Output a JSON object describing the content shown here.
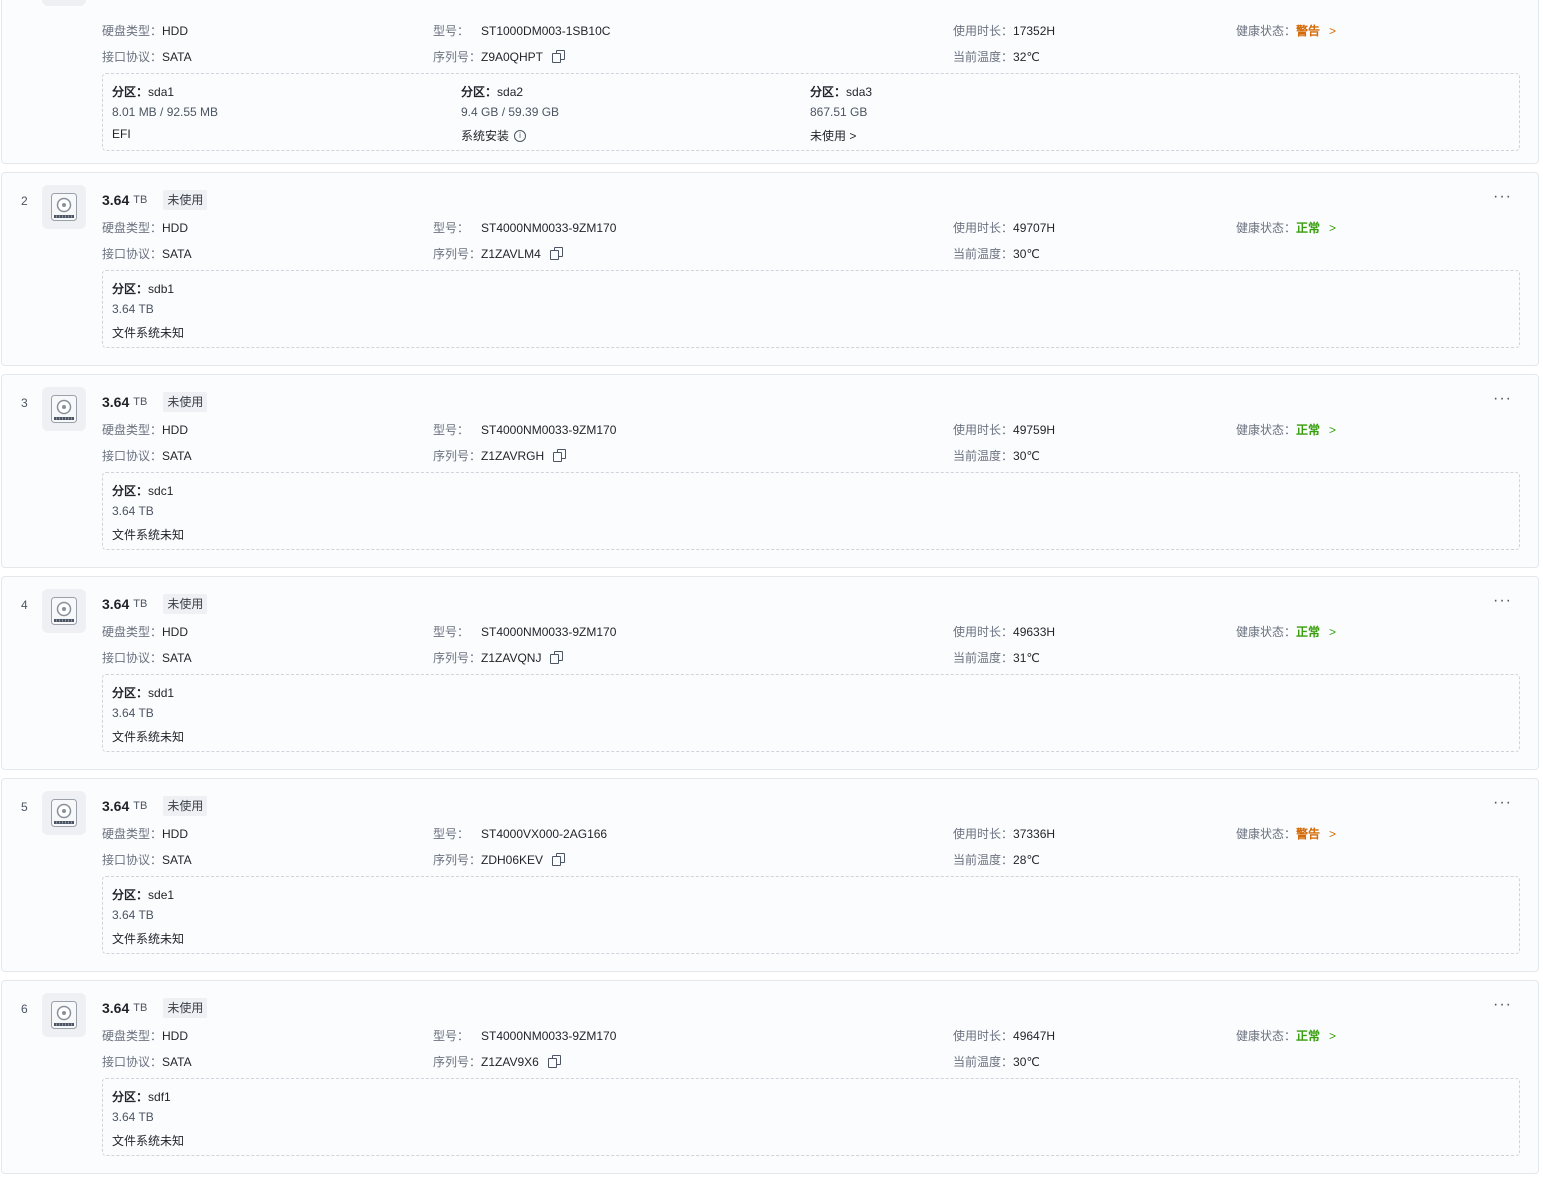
{
  "labels": {
    "disk_type": "硬盘类型：",
    "interface": "接口协议：",
    "model": "型号：",
    "serial": "序列号：",
    "uptime": "使用时长：",
    "temperature": "当前温度：",
    "health": "健康状态：",
    "partition": "分区：",
    "more": "···",
    "chevron": ">"
  },
  "disks": [
    {
      "index": "",
      "size": "",
      "unit": "",
      "usage": "",
      "type": "HDD",
      "interface": "SATA",
      "model": "ST1000DM003-1SB10C",
      "serial": "Z9A0QHPT",
      "uptime": "17352H",
      "temperature": "32℃",
      "health": "警告",
      "health_state": "warning",
      "partitions": [
        {
          "name": "sda1",
          "size": "8.01 MB / 92.55 MB",
          "fs": "EFI"
        },
        {
          "name": "sda2",
          "size": "9.4 GB / 59.39 GB",
          "fs": "系统安装",
          "fs_icon": "info-icon"
        },
        {
          "name": "sda3",
          "size": "867.51 GB",
          "fs": "未使用 >"
        }
      ]
    },
    {
      "index": "2",
      "size": "3.64",
      "unit": "TB",
      "usage": "未使用",
      "type": "HDD",
      "interface": "SATA",
      "model": "ST4000NM0033-9ZM170",
      "serial": "Z1ZAVLM4",
      "uptime": "49707H",
      "temperature": "30℃",
      "health": "正常",
      "health_state": "ok",
      "partitions": [
        {
          "name": "sdb1",
          "size": "3.64 TB",
          "fs": "文件系统未知"
        }
      ]
    },
    {
      "index": "3",
      "size": "3.64",
      "unit": "TB",
      "usage": "未使用",
      "type": "HDD",
      "interface": "SATA",
      "model": "ST4000NM0033-9ZM170",
      "serial": "Z1ZAVRGH",
      "uptime": "49759H",
      "temperature": "30℃",
      "health": "正常",
      "health_state": "ok",
      "partitions": [
        {
          "name": "sdc1",
          "size": "3.64 TB",
          "fs": "文件系统未知"
        }
      ]
    },
    {
      "index": "4",
      "size": "3.64",
      "unit": "TB",
      "usage": "未使用",
      "type": "HDD",
      "interface": "SATA",
      "model": "ST4000NM0033-9ZM170",
      "serial": "Z1ZAVQNJ",
      "uptime": "49633H",
      "temperature": "31℃",
      "health": "正常",
      "health_state": "ok",
      "partitions": [
        {
          "name": "sdd1",
          "size": "3.64 TB",
          "fs": "文件系统未知"
        }
      ]
    },
    {
      "index": "5",
      "size": "3.64",
      "unit": "TB",
      "usage": "未使用",
      "type": "HDD",
      "interface": "SATA",
      "model": "ST4000VX000-2AG166",
      "serial": "ZDH06KEV",
      "uptime": "37336H",
      "temperature": "28℃",
      "health": "警告",
      "health_state": "warning",
      "partitions": [
        {
          "name": "sde1",
          "size": "3.64 TB",
          "fs": "文件系统未知"
        }
      ]
    },
    {
      "index": "6",
      "size": "3.64",
      "unit": "TB",
      "usage": "未使用",
      "type": "HDD",
      "interface": "SATA",
      "model": "ST4000NM0033-9ZM170",
      "serial": "Z1ZAV9X6",
      "uptime": "49647H",
      "temperature": "30℃",
      "health": "正常",
      "health_state": "ok",
      "partitions": [
        {
          "name": "sdf1",
          "size": "3.64 TB",
          "fs": "文件系统未知"
        }
      ]
    }
  ],
  "colors": {
    "warning": "#d46b08",
    "ok": "#389e0d",
    "border": "#e4e7ec",
    "card_bg": "#fbfcfd"
  }
}
